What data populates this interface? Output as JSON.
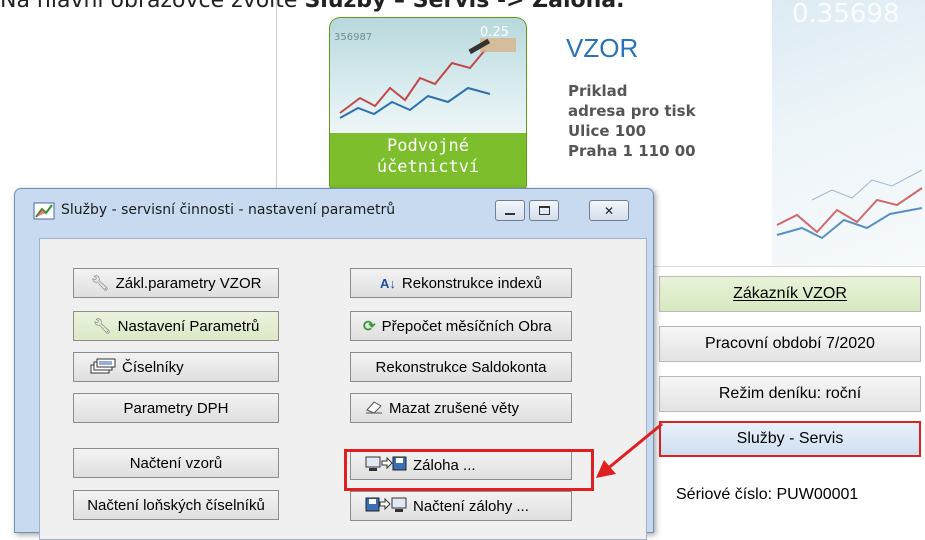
{
  "instruction": {
    "prefix": "Na hlavní obrazovce zvolte ",
    "bold": "Služby – Servis -> Záloha."
  },
  "logo": {
    "caption_line1": "Podvojné",
    "caption_line2": "účetnictví",
    "photo_numbers": "356987",
    "photo_numbers2": "0.25"
  },
  "company": {
    "name": "VZOR",
    "address_line1": "Priklad",
    "address_line2": "adresa pro tisk",
    "address_line3": "Ulice 100",
    "address_line4": "Praha 1  110 00"
  },
  "right_photo_text": "0.35698",
  "right_panel": {
    "zakaznik": "Zákazník  VZOR",
    "obdobi": "Pracovní období  7/2020",
    "rezim": "Režim deníku: roční",
    "sluzby": "Služby - Servis",
    "serial": "Sériové číslo: PUW00001"
  },
  "dialog": {
    "title": "Služby - servisní činnosti - nastavení parametrů",
    "buttons": {
      "zakl": "Zákl.parametry VZOR",
      "nastaveni": "Nastavení Parametrů",
      "ciselniky": "Číselníky",
      "dph": "Parametry DPH",
      "vzoru": "Načtení vzorů",
      "lonskych": "Načtení loňských číselníků",
      "rekonstrukce_indexu": "Rekonstrukce indexů",
      "prepocet": "Přepočet měsíčních Obra",
      "saldokonta": "Rekonstrukce Saldokonta",
      "mazat": "Mazat zrušené věty",
      "zaloha": "Záloha ...",
      "nacteni_zalohy": "Načtení zálohy ..."
    }
  },
  "colors": {
    "highlight": "#e02020",
    "company_name": "#2a73b8",
    "logo_green": "#7cbe2b"
  }
}
